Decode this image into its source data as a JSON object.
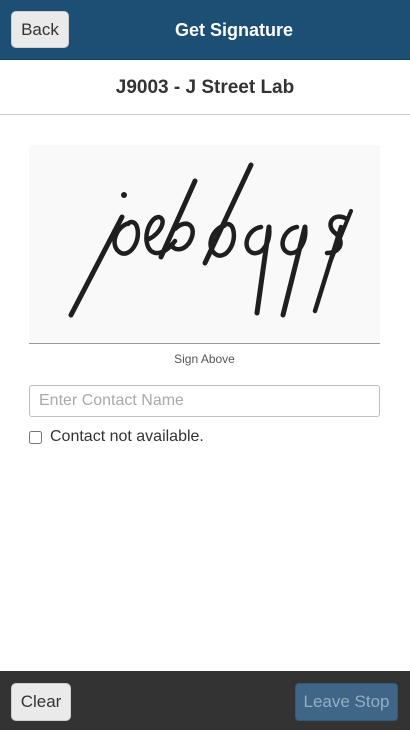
{
  "header": {
    "back_label": "Back",
    "title": "Get Signature"
  },
  "stop": {
    "title": "J9003 - J Street Lab"
  },
  "signature": {
    "text": "joebloggs",
    "caption": "Sign Above"
  },
  "contact": {
    "placeholder": "Enter Contact Name",
    "value": "",
    "not_available_label": "Contact not available.",
    "not_available_checked": false
  },
  "footer": {
    "clear_label": "Clear",
    "leave_label": "Leave Stop",
    "leave_enabled": false
  },
  "colors": {
    "header_bg": "#1d4e74",
    "footer_bg": "#333333",
    "disabled_button": "#3f6687"
  }
}
